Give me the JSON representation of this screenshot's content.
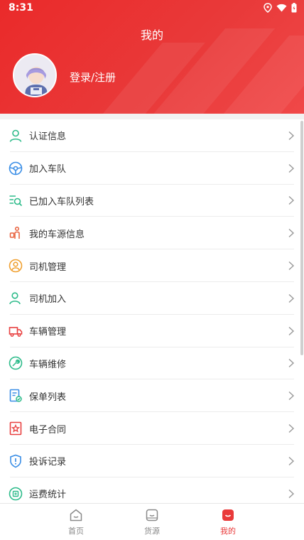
{
  "status_bar": {
    "time": "8:31"
  },
  "header": {
    "title": "我的",
    "login_label": "登录/注册"
  },
  "menu": [
    {
      "label": "认证信息",
      "icon": "user-verify-icon",
      "color": "#2dbb8a"
    },
    {
      "label": "加入车队",
      "icon": "steering-wheel-icon",
      "color": "#3a8ee6"
    },
    {
      "label": "已加入车队列表",
      "icon": "list-search-icon",
      "color": "#2dbb8a"
    },
    {
      "label": "我的车源信息",
      "icon": "vehicle-info-icon",
      "color": "#e8603c"
    },
    {
      "label": "司机管理",
      "icon": "driver-manage-icon",
      "color": "#f0a030"
    },
    {
      "label": "司机加入",
      "icon": "driver-join-icon",
      "color": "#2dbb8a"
    },
    {
      "label": "车辆管理",
      "icon": "truck-icon",
      "color": "#e84040"
    },
    {
      "label": "车辆维修",
      "icon": "wrench-icon",
      "color": "#2dbb8a"
    },
    {
      "label": "保单列表",
      "icon": "policy-list-icon",
      "color": "#3a8ee6"
    },
    {
      "label": "电子合同",
      "icon": "contract-icon",
      "color": "#e84040"
    },
    {
      "label": "投诉记录",
      "icon": "complaint-shield-icon",
      "color": "#3a8ee6"
    },
    {
      "label": "运费统计",
      "icon": "freight-stats-icon",
      "color": "#2dbb8a"
    }
  ],
  "tabbar": {
    "items": [
      {
        "label": "首页",
        "icon": "home-icon"
      },
      {
        "label": "货源",
        "icon": "goods-source-icon"
      },
      {
        "label": "我的",
        "icon": "mine-icon",
        "active": true
      }
    ]
  },
  "colors": {
    "brand": "#e93a3a",
    "inactive": "#888888"
  }
}
